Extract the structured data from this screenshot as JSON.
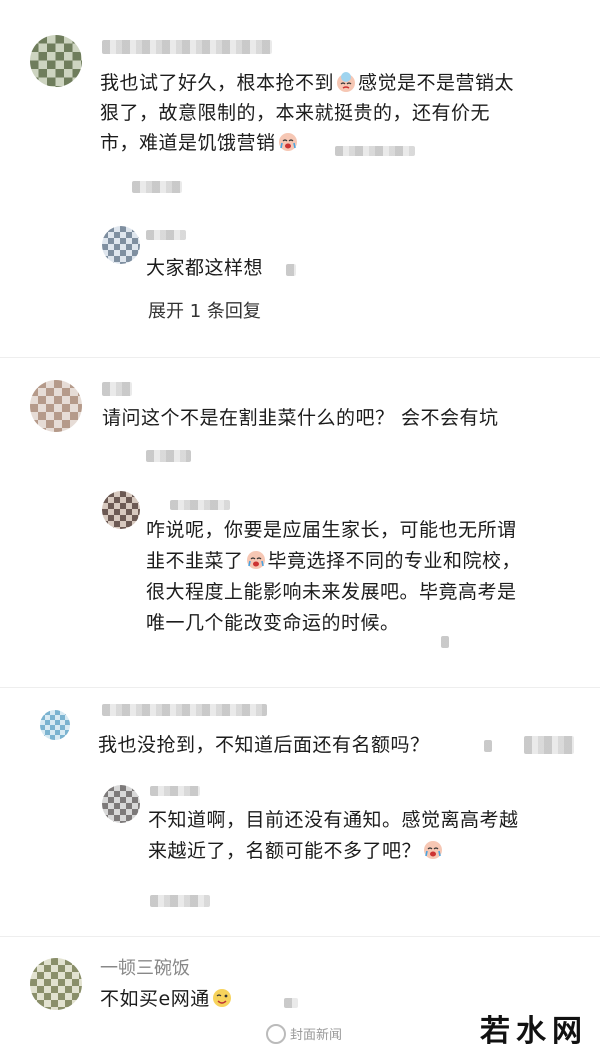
{
  "comments": [
    {
      "text_parts": [
        "我也试了好久，根本抢不到",
        "感觉是不是营销太",
        "狠了，故意限制的，本来就挺贵的，还有价无",
        "市，难道是饥饿营销"
      ],
      "reply": {
        "text": "大家都这样想",
        "expand_label": "展开 1 条回复"
      }
    },
    {
      "text": "请问这个不是在割韭菜什么的吧？ 会不会有坑",
      "reply": {
        "lines": [
          "咋说呢，你要是应届生家长，可能也无所谓",
          "韭不韭菜了",
          "毕竟选择不同的专业和院校，",
          "很大程度上能影响未来发展吧。毕竟高考是",
          "唯一几个能改变命运的时候。"
        ]
      }
    },
    {
      "text": "我也没抢到，不知道后面还有名额吗？",
      "reply": {
        "lines": [
          "不知道啊，目前还没有通知。感觉离高考越",
          "来越近了，名额可能不多了吧？"
        ]
      }
    },
    {
      "username": "一顿三碗饭",
      "text": "不如买e网通"
    }
  ],
  "watermark": {
    "brand": "若水网",
    "source": "封面新闻"
  },
  "icons": {
    "crying": "crying-emoji-icon",
    "sad": "sad-emoji-icon",
    "wink": "wink-emoji-icon"
  }
}
